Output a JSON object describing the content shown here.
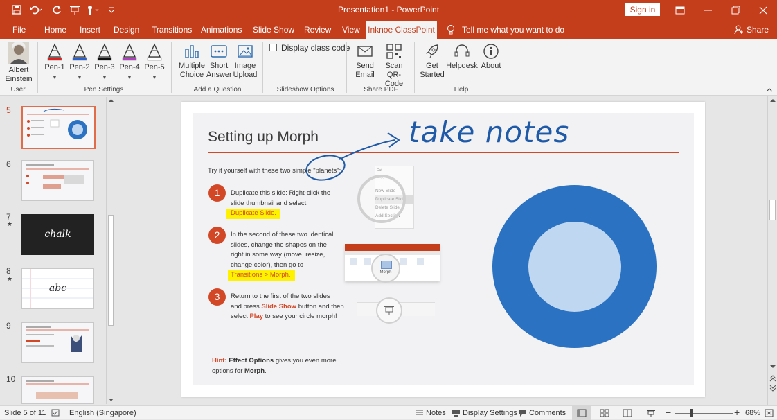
{
  "window": {
    "title": "Presentation1  -  PowerPoint",
    "sign_in": "Sign in"
  },
  "tabs": [
    "File",
    "Home",
    "Insert",
    "Design",
    "Transitions",
    "Animations",
    "Slide Show",
    "Review",
    "View"
  ],
  "active_tab": "Inknoe ClassPoint",
  "tell_me": "Tell me what you want to do",
  "share": "Share",
  "ribbon": {
    "user": {
      "label_line1": "Albert",
      "label_line2": "Einstein",
      "group": "User"
    },
    "pens": [
      "Pen-1",
      "Pen-2",
      "Pen-3",
      "Pen-4",
      "Pen-5"
    ],
    "pen_colors": [
      "#e02020",
      "#2a5fd0",
      "#111111",
      "#b040c0",
      "#ffffff"
    ],
    "pen_group": "Pen Settings",
    "question": {
      "mc1": "Multiple",
      "mc2": "Choice",
      "sa1": "Short",
      "sa2": "Answer",
      "iu1": "Image",
      "iu2": "Upload",
      "group": "Add a Question"
    },
    "slideshow": {
      "checkbox": "Display class code",
      "group": "Slideshow Options"
    },
    "sharepdf": {
      "se1": "Send",
      "se2": "Email",
      "qr1": "Scan QR-",
      "qr2": "Code",
      "group": "Share PDF"
    },
    "help": {
      "gs1": "Get",
      "gs2": "Started",
      "helpdesk": "Helpdesk",
      "about": "About",
      "group": "Help"
    }
  },
  "thumbnails": [
    {
      "num": "5",
      "star": ""
    },
    {
      "num": "6",
      "star": ""
    },
    {
      "num": "7",
      "star": "★",
      "text": "chalk"
    },
    {
      "num": "8",
      "star": "★",
      "text": "abc"
    },
    {
      "num": "9",
      "star": ""
    },
    {
      "num": "10",
      "star": ""
    }
  ],
  "slide": {
    "title": "Setting up Morph",
    "ink_text": "take notes",
    "intro": "Try it yourself with these two simple \"planets\":",
    "steps": [
      {
        "n": "1",
        "l1": "Duplicate this slide: Right-click the",
        "l2": "slide thumbnail and select",
        "hl": "Duplicate Slide."
      },
      {
        "n": "2",
        "l1": "In the second of these two identical",
        "l2": "slides, change the shapes on the",
        "l3": "right in some way (move, resize,",
        "l4": "change color), then go to",
        "hl": "Transitions > Morph."
      },
      {
        "n": "3",
        "l1": "Return to the first of the two slides",
        "l2a": "and press ",
        "l2b": "Slide Show",
        "l2c": " button and then",
        "l3a": "select ",
        "l3b": "Play",
        "l3c": " to see your circle morph!"
      }
    ],
    "hint": {
      "a": "Hint:",
      "b": " Effect Options",
      "c": " gives you even more",
      "d": "options for ",
      "e": "Morph",
      "f": "."
    },
    "menu": [
      "Cut",
      "Copy",
      "New Slide",
      "Duplicate Slide",
      "Delete Slide",
      "Add Section"
    ],
    "morph": "Morph"
  },
  "status": {
    "slide": "Slide 5 of 11",
    "lang": "English (Singapore)",
    "notes": "Notes",
    "display": "Display Settings",
    "comments": "Comments",
    "zoom": "68%"
  }
}
